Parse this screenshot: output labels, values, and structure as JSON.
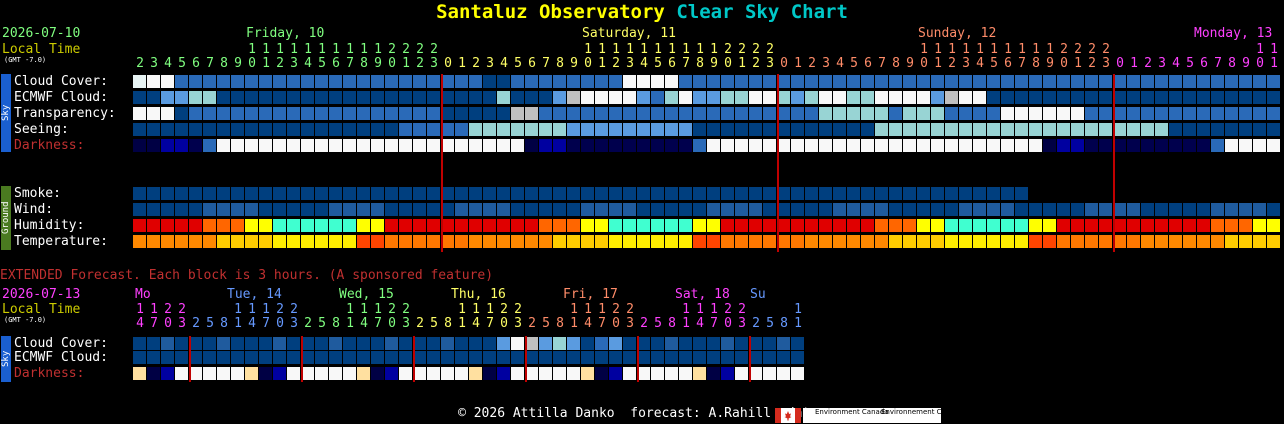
{
  "title": {
    "name": "Santaluz Observatory",
    "suffix": "Clear Sky Chart"
  },
  "main": {
    "date": "2026-07-10",
    "local_time": "Local Time",
    "gmt": "(GMT -7.0)",
    "days": [
      {
        "label": "Friday, 10",
        "color": "#80ff80"
      },
      {
        "label": "Saturday, 11",
        "color": "#ffff66"
      },
      {
        "label": "Sunday, 12",
        "color": "#ff8c69"
      },
      {
        "label": "Monday, 13",
        "color": "#ff40ff"
      }
    ],
    "hours": [
      2,
      3,
      4,
      5,
      6,
      7,
      8,
      9,
      10,
      11,
      12,
      13,
      14,
      15,
      16,
      17,
      18,
      19,
      20,
      21,
      22,
      23,
      0,
      1,
      2,
      3,
      4,
      5,
      6,
      7,
      8,
      9,
      10,
      11,
      12,
      13,
      14,
      15,
      16,
      17,
      18,
      19,
      20,
      21,
      22,
      23,
      0,
      1,
      2,
      3,
      4,
      5,
      6,
      7,
      8,
      9,
      10,
      11,
      12,
      13,
      14,
      15,
      16,
      17,
      18,
      19,
      20,
      21,
      22,
      23,
      0,
      1,
      2,
      3,
      4,
      5,
      6,
      7,
      8,
      9,
      10,
      11
    ],
    "sky_side": "Sky",
    "ground_side": "Ground",
    "sky_rows": [
      {
        "label": "Cloud Cover:",
        "key": "cloud"
      },
      {
        "label": "ECMWF Cloud:",
        "key": "ecmwf"
      },
      {
        "label": "Transparency:",
        "key": "transp"
      },
      {
        "label": "Seeing:",
        "key": "seeing"
      },
      {
        "label": "Darkness:",
        "key": "dark"
      }
    ],
    "ground_rows": [
      {
        "label": "Smoke:",
        "key": "smoke"
      },
      {
        "label": "Wind:",
        "key": "wind"
      },
      {
        "label": "Humidity:",
        "key": "hum"
      },
      {
        "label": "Temperature:",
        "key": "temp"
      }
    ]
  },
  "extended": {
    "notice": "EXTENDED Forecast. Each block is 3 hours. (A sponsored feature)",
    "date": "2026-07-13",
    "local_time": "Local Time",
    "gmt": "(GMT -7.0)",
    "days": [
      {
        "label": "Mo",
        "color": "#ff40ff"
      },
      {
        "label": "Tue, 14",
        "color": "#6699ff"
      },
      {
        "label": "Wed, 15",
        "color": "#80ff80"
      },
      {
        "label": "Thu, 16",
        "color": "#ffff66"
      },
      {
        "label": "Fri, 17",
        "color": "#ff8c69"
      },
      {
        "label": "Sat, 18",
        "color": "#ff40ff"
      },
      {
        "label": "Su",
        "color": "#6699ff"
      }
    ],
    "hours": [
      14,
      17,
      20,
      23,
      2,
      5,
      8,
      11,
      14,
      17,
      20,
      23,
      2,
      5,
      8,
      11,
      14,
      17,
      20,
      23,
      2,
      5,
      8,
      11,
      14,
      17,
      20,
      23,
      2,
      5,
      8,
      11,
      14,
      17,
      20,
      23,
      2,
      5,
      8,
      11,
      14,
      17,
      20,
      23,
      2,
      5,
      8,
      11
    ],
    "rows": [
      {
        "label": "Cloud Cover:",
        "key": "cloud"
      },
      {
        "label": "ECMWF Cloud:",
        "key": "ecmwf"
      },
      {
        "label": "Darkness:",
        "key": "dark"
      }
    ]
  },
  "footer": {
    "text": "© 2026 Attilla Danko  forecast: A.Rahill  data:",
    "agency": "Environment Canada",
    "agency_fr": "Environnement Canada"
  },
  "colors": {
    "cloud_clear": "#003f7f",
    "darkness_label": "#c03030",
    "day_divider": "#c00000",
    "extended_notice": "#c03030",
    "local_time": "#cccc00",
    "date": "#80ff80",
    "ext_date": "#ff40ff"
  },
  "chart_data": {
    "main_sky_values": {
      "cloud": "cwwbbbbbbbbbbbbbbbbbbbbbbBBbbbbbbbbwwwwbbbbbbbbbbbbbbbbbbbbbbbbbbbbbbbbbbbbbbbbbbbBBBBBBtwttbbbbbbbbbbbbbbbbbbbb",
      "ecmwf": "BBllttBBBBBBBBBBBBBBBBBBBBtBBBlgwwwwlbtwllttwwtltwwttwwwwlgwwBBBBBBBBBBBBBBBBBBBBBBBwwwwwwBBBBBBBBBBBBB",
      "transp": "wwwBbbbbbbbbbbbbbbbbbbBBBBBggbbbbbbbbbbbbbbbbbbbbtttttbtttbbbbwwwwwwbbbbbbbbbbbbbbbbbbbbtttttttttttttbbb",
      "seeing": "BBBBBBBBBBBBBBBBBBBbbbbbtttttttlllllllllBBBBBBBBBBBBBtttttttttttttttttttttBBBBBBBBlllllBBBBBBBlllllllwwBBBBBBBBBBBBBBBb",
      "dark": "ddmmkbwwwwwwwwwwwwwwwwwwwwwwdmmkkkkkkkkkbwwwwwwwwwwwwwwwwwwwwwwwwdmmkkkkkkkkkbwwwwwwwwwwwwwwwwwwwwwwwdmmkkkkkkkbwwwwwwww"
    }
  }
}
